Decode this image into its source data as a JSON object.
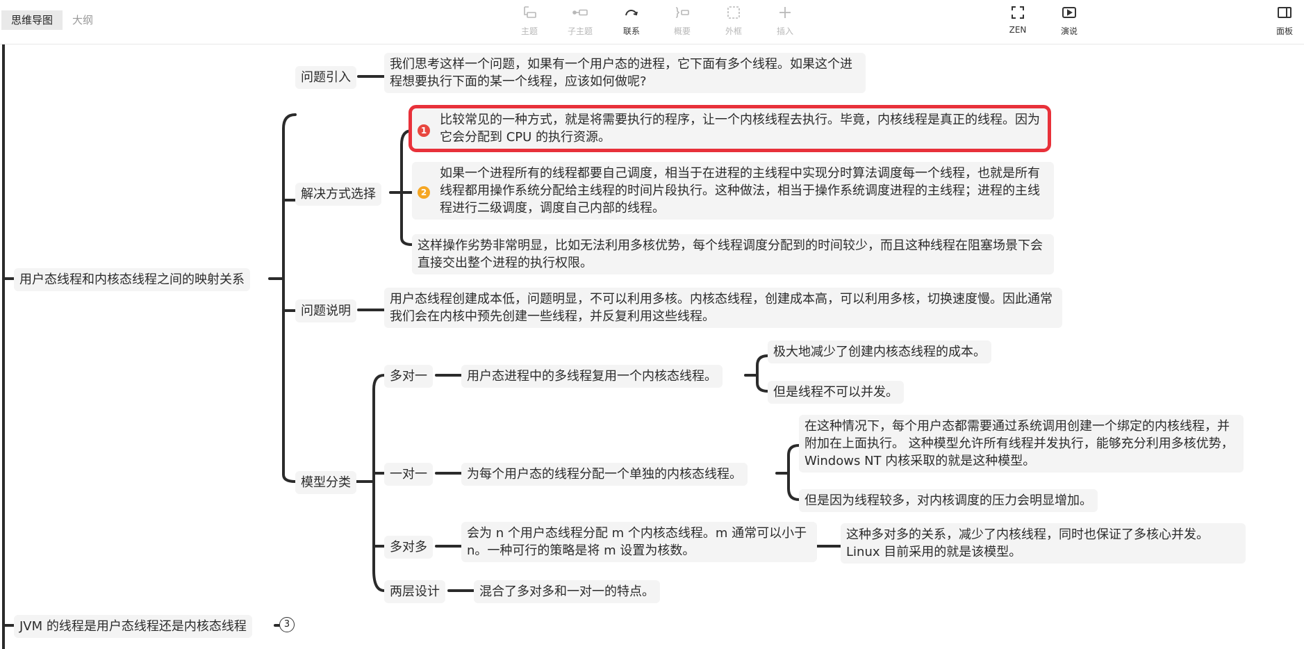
{
  "tabs": [
    "思维导图",
    "大纲"
  ],
  "toolbar": {
    "topic": "主题",
    "subtopic": "子主题",
    "link": "联系",
    "summary": "概要",
    "frame": "外框",
    "insert": "插入",
    "zen": "ZEN",
    "present": "演说",
    "panel": "面板"
  },
  "icons": {
    "topic": "topic-icon",
    "subtopic": "subtopic-icon",
    "link": "relationship-arrow-icon",
    "summary": "summary-brace-icon",
    "frame": "boundary-frame-icon",
    "insert": "plus-icon",
    "zen": "fullscreen-icon",
    "present": "play-screen-icon",
    "panel": "side-panel-icon"
  },
  "colors": {
    "selection": "#e8313a",
    "marker_red": "#e8473f",
    "marker_yellow": "#f5a623",
    "line": "#2b2b2b"
  },
  "map": {
    "main_topic": "用户态线程和内核态线程之间的映射关系",
    "q_intro": {
      "label": "问题引入",
      "text": "我们思考这样一个问题，如果有一个用户态的进程，它下面有多个线程。如果这个进程想要执行下面的某一个线程，应该如何做呢?"
    },
    "solutions": {
      "label": "解决方式选择",
      "option1": {
        "marker": "1",
        "text": "比较常见的一种方式，就是将需要执行的程序，让一个内核线程去执行。毕竟，内核线程是真正的线程。因为它会分配到 CPU 的执行资源。"
      },
      "option2": {
        "marker": "2",
        "text": "如果一个进程所有的线程都要自己调度，相当于在进程的主线程中实现分时算法调度每一个线程，也就是所有线程都用操作系统分配给主线程的时间片段执行。这种做法，相当于操作系统调度进程的主线程；进程的主线程进行二级调度，调度自己内部的线程。"
      },
      "drawback": "这样操作劣势非常明显，比如无法利用多核优势，每个线程调度分配到的时间较少，而且这种线程在阻塞场景下会直接交出整个进程的执行权限。"
    },
    "q_explain": {
      "label": "问题说明",
      "text": "用户态线程创建成本低，问题明显，不可以利用多核。内核态线程，创建成本高，可以利用多核，切换速度慢。因此通常我们会在内核中预先创建一些线程，并反复利用这些线程。"
    },
    "models": {
      "label": "模型分类",
      "many_to_one": {
        "label": "多对一",
        "desc": "用户态进程中的多线程复用一个内核态线程。",
        "pro": "极大地减少了创建内核态线程的成本。",
        "con": "但是线程不可以并发。"
      },
      "one_to_one": {
        "label": "一对一",
        "desc": "为每个用户态的线程分配一个单独的内核态线程。",
        "pro": "在这种情况下，每个用户态都需要通过系统调用创建一个绑定的内核线程，并附加在上面执行。 这种模型允许所有线程并发执行，能够充分利用多核优势，Windows NT 内核采取的就是这种模型。",
        "con": "但是因为线程较多，对内核调度的压力会明显增加。"
      },
      "many_to_many": {
        "label": "多对多",
        "desc": "会为 n 个用户态线程分配 m 个内核态线程。m 通常可以小于 n。一种可行的策略是将 m 设置为核数。",
        "pro": "这种多对多的关系，减少了内核线程，同时也保证了多核心并发。Linux 目前采用的就是该模型。"
      },
      "two_level": {
        "label": "两层设计",
        "desc": "混合了多对多和一对一的特点。"
      }
    },
    "jvm_topic": "JVM 的线程是用户态线程还是内核态线程",
    "jvm_collapsed_count": "3"
  }
}
